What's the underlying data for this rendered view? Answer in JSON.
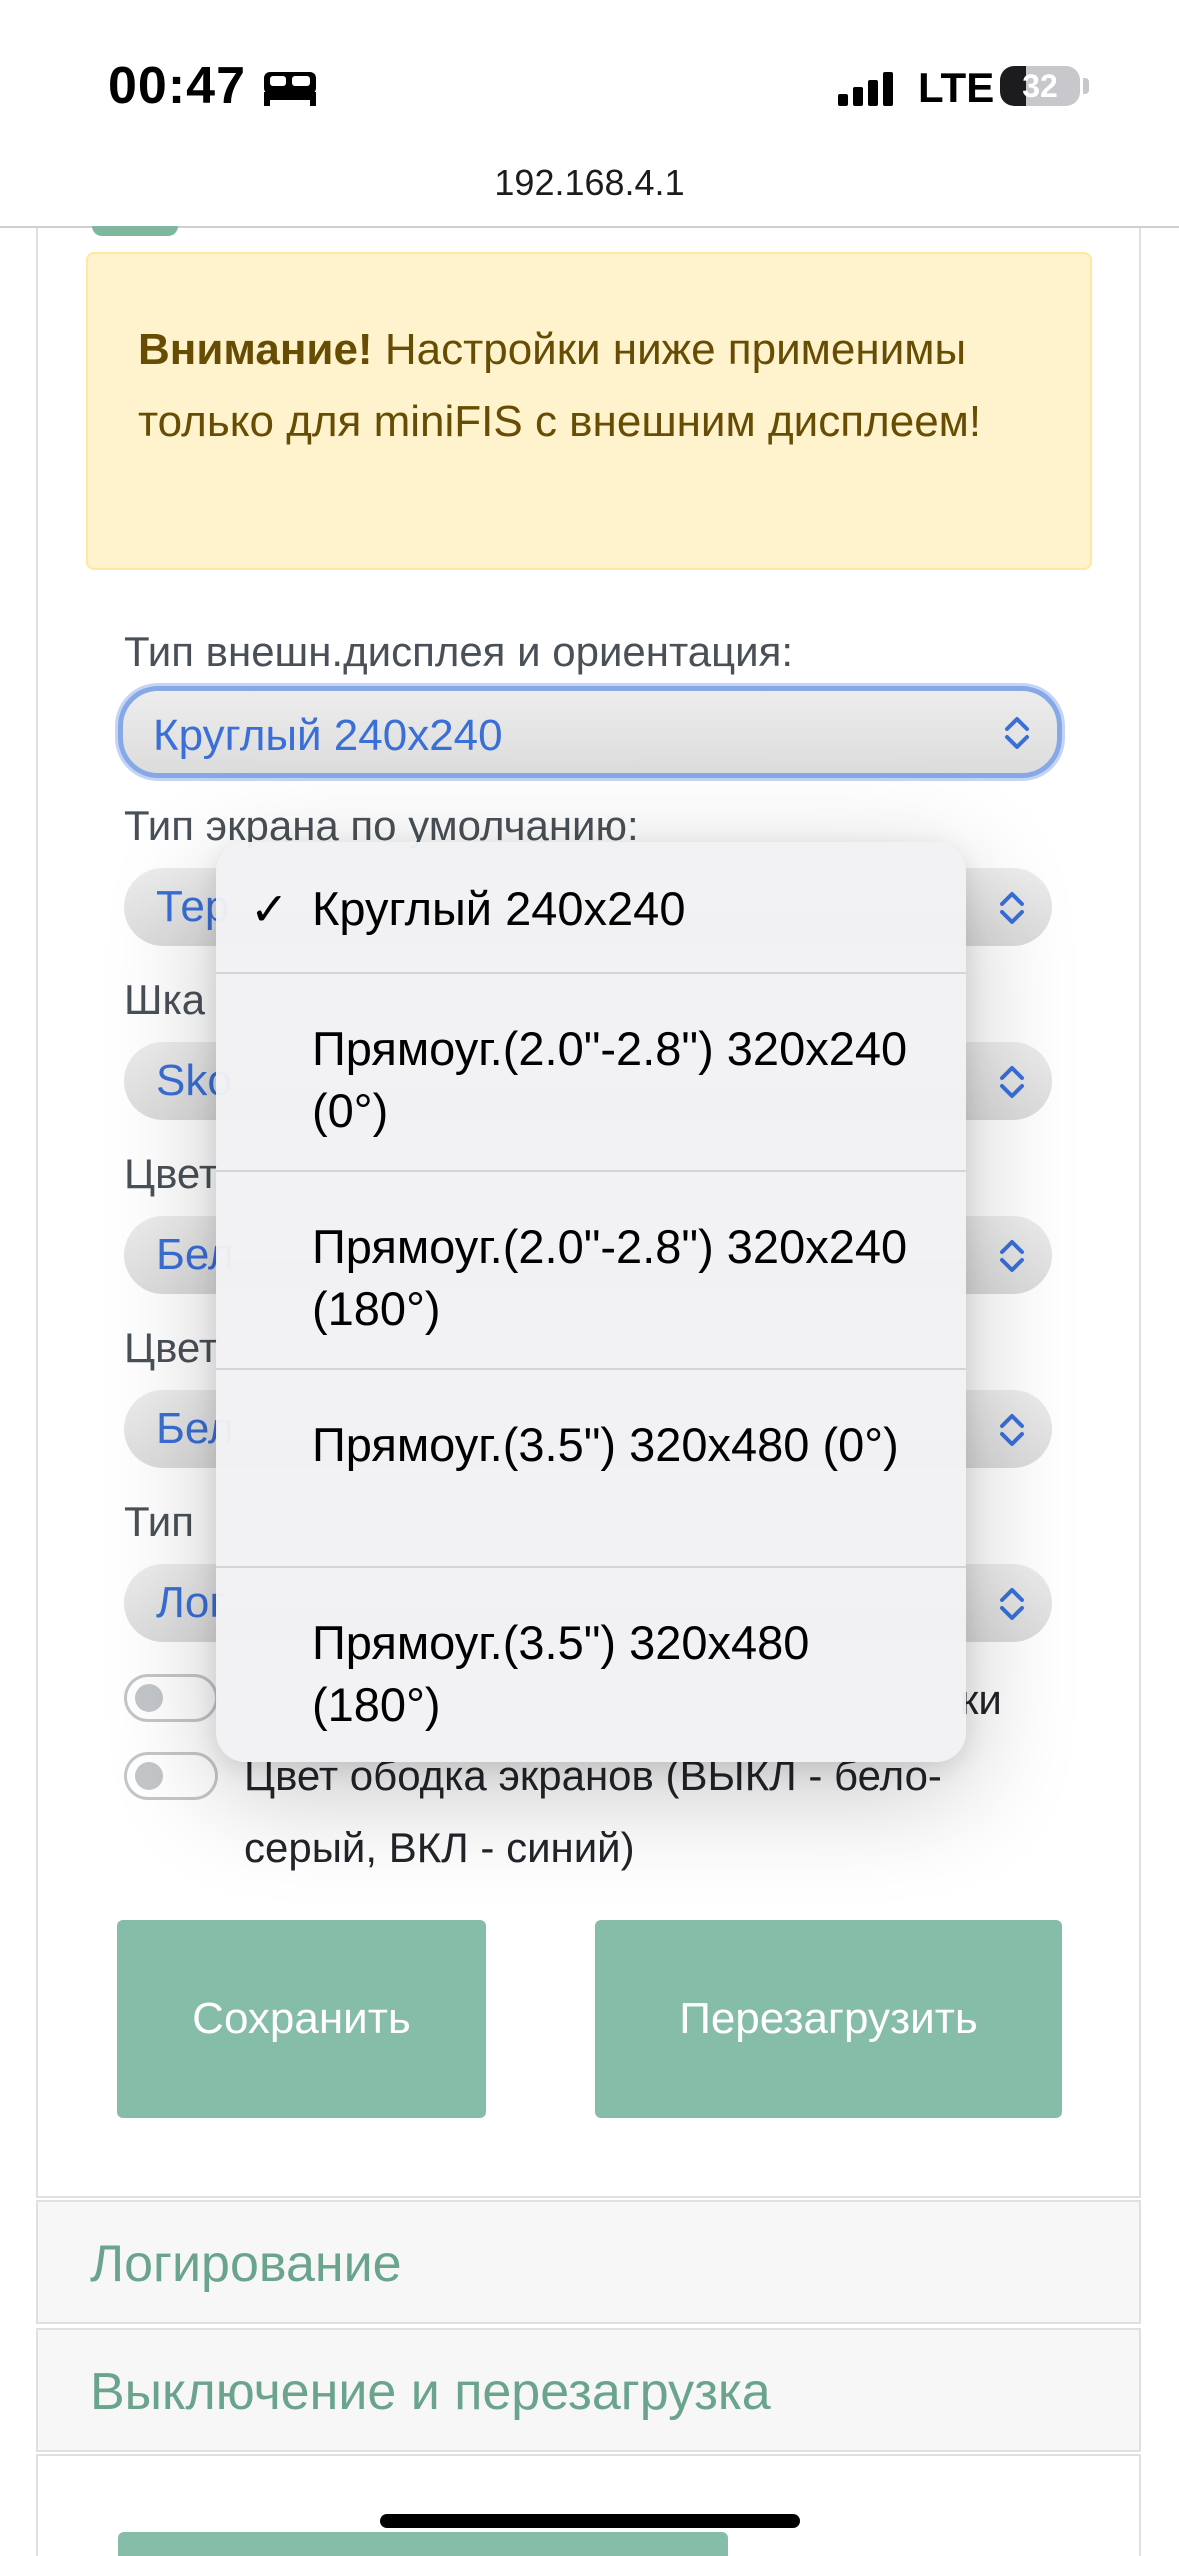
{
  "status_bar": {
    "time": "00:47",
    "network": "LTE",
    "battery_level": "32",
    "icons": [
      "bed-icon",
      "signal-icon",
      "battery-icon"
    ]
  },
  "browser": {
    "url": "192.168.4.1"
  },
  "alert": {
    "strong": "Внимание!",
    "text": " Настройки ниже применимы только для miniFIS с внешним дисплеем!"
  },
  "fields": {
    "display_type": {
      "label": "Тип внешн.дисплея и ориентация:",
      "value": "Круглый 240x240"
    },
    "screen_default": {
      "label": "Тип экрана по умолчанию:",
      "value": "Тер"
    },
    "scale": {
      "label": "Шка",
      "value": "Sko"
    },
    "color1": {
      "label": "Цвет",
      "value": "Бел"
    },
    "color2": {
      "label": "Цвет",
      "value": "Бел"
    },
    "type": {
      "label": "Тип",
      "value": "Лог"
    }
  },
  "toggles": {
    "toggle1_text": "ки",
    "toggle2_text": "Цвет ободка экранов (ВЫКЛ - бело-серый, ВКЛ - синий)"
  },
  "buttons": {
    "save": "Сохранить",
    "reboot": "Перезагрузить"
  },
  "accordion": {
    "logging": "Логирование",
    "shutdown": "Выключение и перезагрузка"
  },
  "dropdown": {
    "options": [
      {
        "label": "Круглый 240x240",
        "selected": true
      },
      {
        "label": "Прямоуг.(2.0\"-2.8\") 320x240 (0°)",
        "selected": false
      },
      {
        "label": "Прямоуг.(2.0\"-2.8\") 320x240 (180°)",
        "selected": false
      },
      {
        "label": "Прямоуг.(3.5\") 320x480 (0°)",
        "selected": false
      },
      {
        "label": "Прямоуг.(3.5\") 320x480 (180°)",
        "selected": false
      }
    ],
    "check_mark": "✓"
  },
  "colors": {
    "accent_green": "#86bda8",
    "accent_text_green": "#6aa48d",
    "select_blue": "#3a6fd8",
    "alert_bg": "#fff3cd"
  }
}
